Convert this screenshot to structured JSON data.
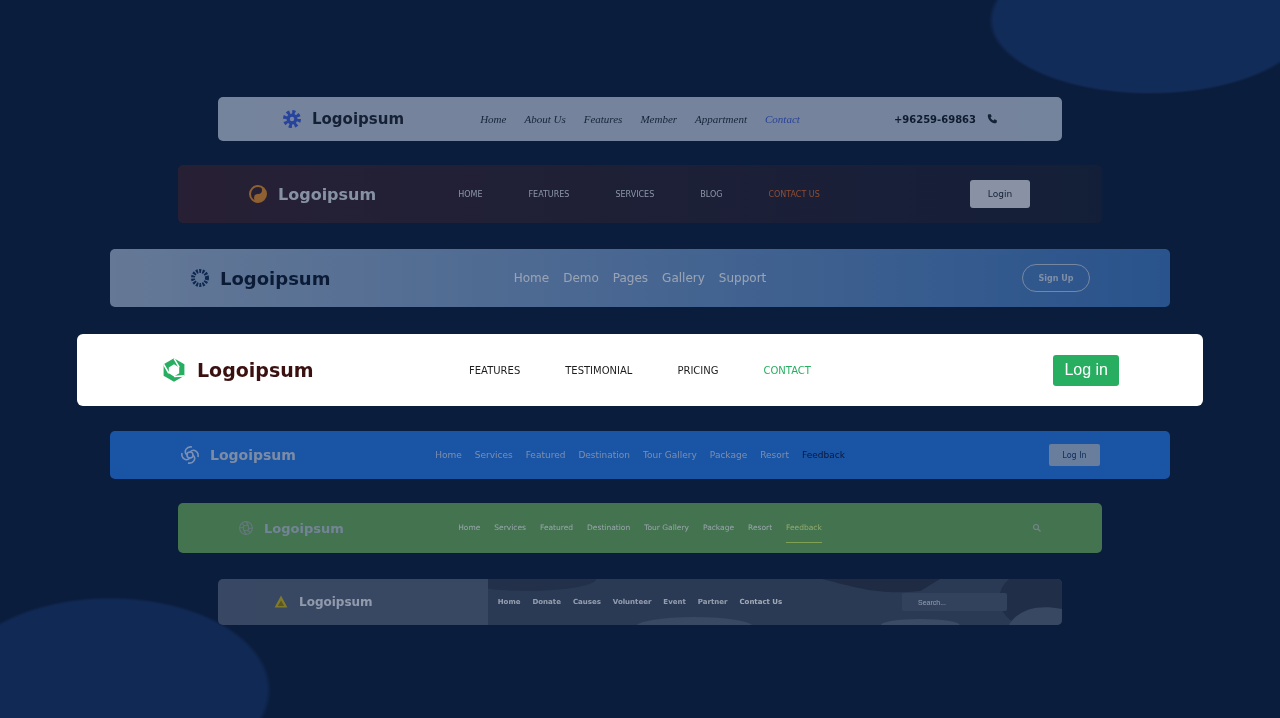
{
  "navbars": [
    {
      "kind": "classic",
      "dimmed": true,
      "brand": "Logoipsum",
      "links": [
        {
          "label": "Home",
          "selected": false
        },
        {
          "label": "About Us",
          "selected": false
        },
        {
          "label": "Features",
          "selected": false
        },
        {
          "label": "Member",
          "selected": false
        },
        {
          "label": "Appartment",
          "selected": false
        },
        {
          "label": "Contact",
          "selected": true
        }
      ],
      "action": {
        "kind": "phone",
        "text": "+96259-69863"
      }
    },
    {
      "kind": "warm",
      "dimmed": true,
      "brand": "Logoipsum",
      "links": [
        {
          "label": "HOME",
          "selected": false
        },
        {
          "label": "FEATURES",
          "selected": false
        },
        {
          "label": "SERVICES",
          "selected": false
        },
        {
          "label": "BLOG",
          "selected": false
        },
        {
          "label": "CONTACT US",
          "selected": true
        }
      ],
      "action": {
        "kind": "button",
        "label": "Login"
      }
    },
    {
      "kind": "glass",
      "dimmed": true,
      "brand": "Logoipsum",
      "links": [
        {
          "label": "Home",
          "selected": false
        },
        {
          "label": "Demo",
          "selected": false
        },
        {
          "label": "Pages",
          "selected": false
        },
        {
          "label": "Gallery",
          "selected": false
        },
        {
          "label": "Support",
          "selected": false
        }
      ],
      "action": {
        "kind": "outline-button",
        "label": "Sign Up"
      }
    },
    {
      "kind": "light",
      "dimmed": false,
      "brand": "Logoipsum",
      "links": [
        {
          "label": "FEATURES",
          "selected": false
        },
        {
          "label": "TESTIMONIAL",
          "selected": false
        },
        {
          "label": "PRICING",
          "selected": false
        },
        {
          "label": "CONTACT",
          "selected": true
        }
      ],
      "action": {
        "kind": "button",
        "label": "Log in"
      }
    },
    {
      "kind": "blue",
      "dimmed": true,
      "brand": "Logoipsum",
      "links": [
        {
          "label": "Home",
          "selected": false
        },
        {
          "label": "Services",
          "selected": false
        },
        {
          "label": "Featured",
          "selected": false
        },
        {
          "label": "Destination",
          "selected": false
        },
        {
          "label": "Tour Gallery",
          "selected": false
        },
        {
          "label": "Package",
          "selected": false
        },
        {
          "label": "Resort",
          "selected": false
        },
        {
          "label": "Feedback",
          "selected": true
        }
      ],
      "action": {
        "kind": "button",
        "label": "Log In"
      }
    },
    {
      "kind": "green",
      "dimmed": true,
      "brand": "Logoipsum",
      "links": [
        {
          "label": "Home",
          "selected": false
        },
        {
          "label": "Services",
          "selected": false
        },
        {
          "label": "Featured",
          "selected": false
        },
        {
          "label": "Destination",
          "selected": false
        },
        {
          "label": "Tour Gallery",
          "selected": false
        },
        {
          "label": "Package",
          "selected": false
        },
        {
          "label": "Resort",
          "selected": false
        },
        {
          "label": "Feedback",
          "selected": true
        }
      ],
      "action": {
        "kind": "search-icon"
      }
    },
    {
      "dimmed": true,
      "brand": "Logoipsum",
      "links": [
        {
          "label": "Home",
          "selected": false
        },
        {
          "label": "Donate",
          "selected": false
        },
        {
          "label": "Causes",
          "selected": false
        },
        {
          "label": "Volunteer",
          "selected": false
        },
        {
          "label": "Event",
          "selected": false
        },
        {
          "label": "Partner",
          "selected": false
        },
        {
          "label": "Contact Us",
          "selected": true
        }
      ],
      "action": {
        "kind": "search-field",
        "placeholder": "Search..."
      }
    }
  ]
}
